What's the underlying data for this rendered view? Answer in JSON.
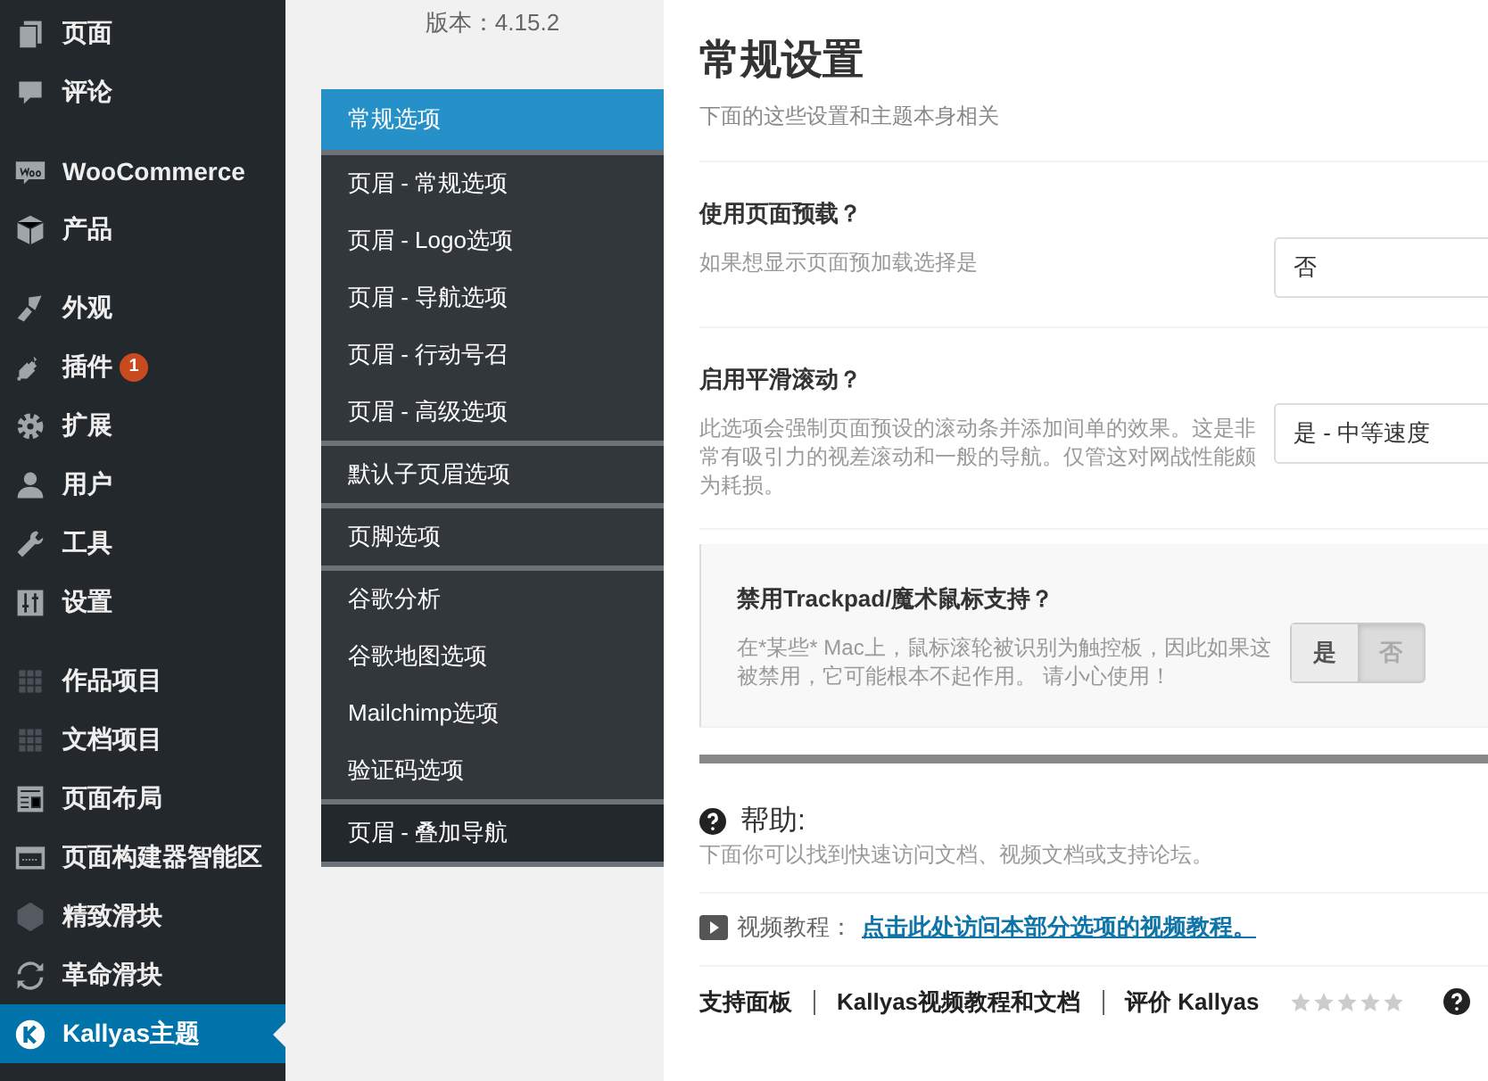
{
  "admin_menu": {
    "groups": [
      {
        "items": [
          {
            "label": "页面",
            "kind": "pages",
            "selected": false
          },
          {
            "label": "评论",
            "kind": "comments",
            "selected": false
          }
        ]
      },
      {
        "items": [
          {
            "label": "WooCommerce",
            "kind": "woo",
            "selected": false
          },
          {
            "label": "产品",
            "kind": "box",
            "selected": false
          }
        ]
      },
      {
        "items": [
          {
            "label": "外观",
            "kind": "brush",
            "selected": false
          },
          {
            "label": "插件",
            "kind": "plug",
            "badge": "1",
            "selected": false
          },
          {
            "label": "扩展",
            "kind": "gear",
            "selected": false
          },
          {
            "label": "用户",
            "kind": "user",
            "selected": false
          },
          {
            "label": "工具",
            "kind": "wrench",
            "selected": false
          },
          {
            "label": "设置",
            "kind": "sliders",
            "selected": false
          }
        ]
      },
      {
        "items": [
          {
            "label": "作品项目",
            "kind": "grid",
            "selected": false
          },
          {
            "label": "文档项目",
            "kind": "grid",
            "selected": false
          },
          {
            "label": "页面布局",
            "kind": "layout",
            "selected": false
          },
          {
            "label": "页面构建器智能区",
            "kind": "builder",
            "selected": false
          },
          {
            "label": "精致滑块",
            "kind": "cube",
            "selected": false
          },
          {
            "label": "革命滑块",
            "kind": "refresh",
            "selected": false
          },
          {
            "label": "Kallyas主题",
            "kind": "k",
            "selected": true
          }
        ]
      }
    ]
  },
  "theme_nav": {
    "version": "版本：4.15.2",
    "groups": [
      {
        "kind": "normal",
        "items": [
          {
            "label": "常规选项",
            "selected": true
          }
        ]
      },
      {
        "kind": "normal",
        "items": [
          {
            "label": "页眉 - 常规选项",
            "selected": false
          },
          {
            "label": "页眉 - Logo选项",
            "selected": false
          },
          {
            "label": "页眉 - 导航选项",
            "selected": false
          },
          {
            "label": "页眉 - 行动号召",
            "selected": false
          },
          {
            "label": "页眉 - 高级选项",
            "selected": false
          }
        ]
      },
      {
        "kind": "normal",
        "items": [
          {
            "label": "默认子页眉选项",
            "selected": false
          }
        ]
      },
      {
        "kind": "normal",
        "items": [
          {
            "label": "页脚选项",
            "selected": false
          }
        ]
      },
      {
        "kind": "normal",
        "items": [
          {
            "label": "谷歌分析",
            "selected": false
          },
          {
            "label": "谷歌地图选项",
            "selected": false
          },
          {
            "label": "Mailchimp选项",
            "selected": false
          },
          {
            "label": "验证码选项",
            "selected": false
          }
        ]
      },
      {
        "kind": "dark",
        "items": [
          {
            "label": "页眉 - 叠加导航",
            "selected": false
          }
        ]
      }
    ]
  },
  "content": {
    "title": "常规设置",
    "subtitle": "下面的这些设置和主题本身相关",
    "options": [
      {
        "kind": "select",
        "label": "使用页面预载？",
        "description": "如果想显示页面预加载选择是",
        "value": "否"
      },
      {
        "kind": "select",
        "label": "启用平滑滚动？",
        "description": "此选项会强制页面预设的滚动条并添加间单的效果。这是非常有吸引力的视差滚动和一般的导航。仅管这对网战性能颇为耗损。",
        "value": "是 - 中等速度"
      },
      {
        "kind": "toggle",
        "label": "禁用Trackpad/魔术鼠标支持？",
        "description": "在*某些* Mac上，鼠标滚轮被识别为触控板，因此如果这被禁用，它可能根本不起作用。 请小心使用！",
        "choices": [
          {
            "label": "是",
            "selected": false
          },
          {
            "label": "否",
            "selected": true
          }
        ]
      }
    ],
    "help": {
      "title": "帮助:",
      "description": "下面你可以找到快速访问文档、视频文档或支持论坛。",
      "video_label": "视频教程：",
      "video_link": "点击此处访问本部分选项的视频教程。",
      "footer_links": [
        {
          "kind": "link",
          "text": "支持面板"
        },
        {
          "kind": "link",
          "text": "Kallyas视频教程和文档"
        },
        {
          "kind": "rating",
          "text": "**评价** Kallyas",
          "stars": 0
        }
      ]
    }
  }
}
